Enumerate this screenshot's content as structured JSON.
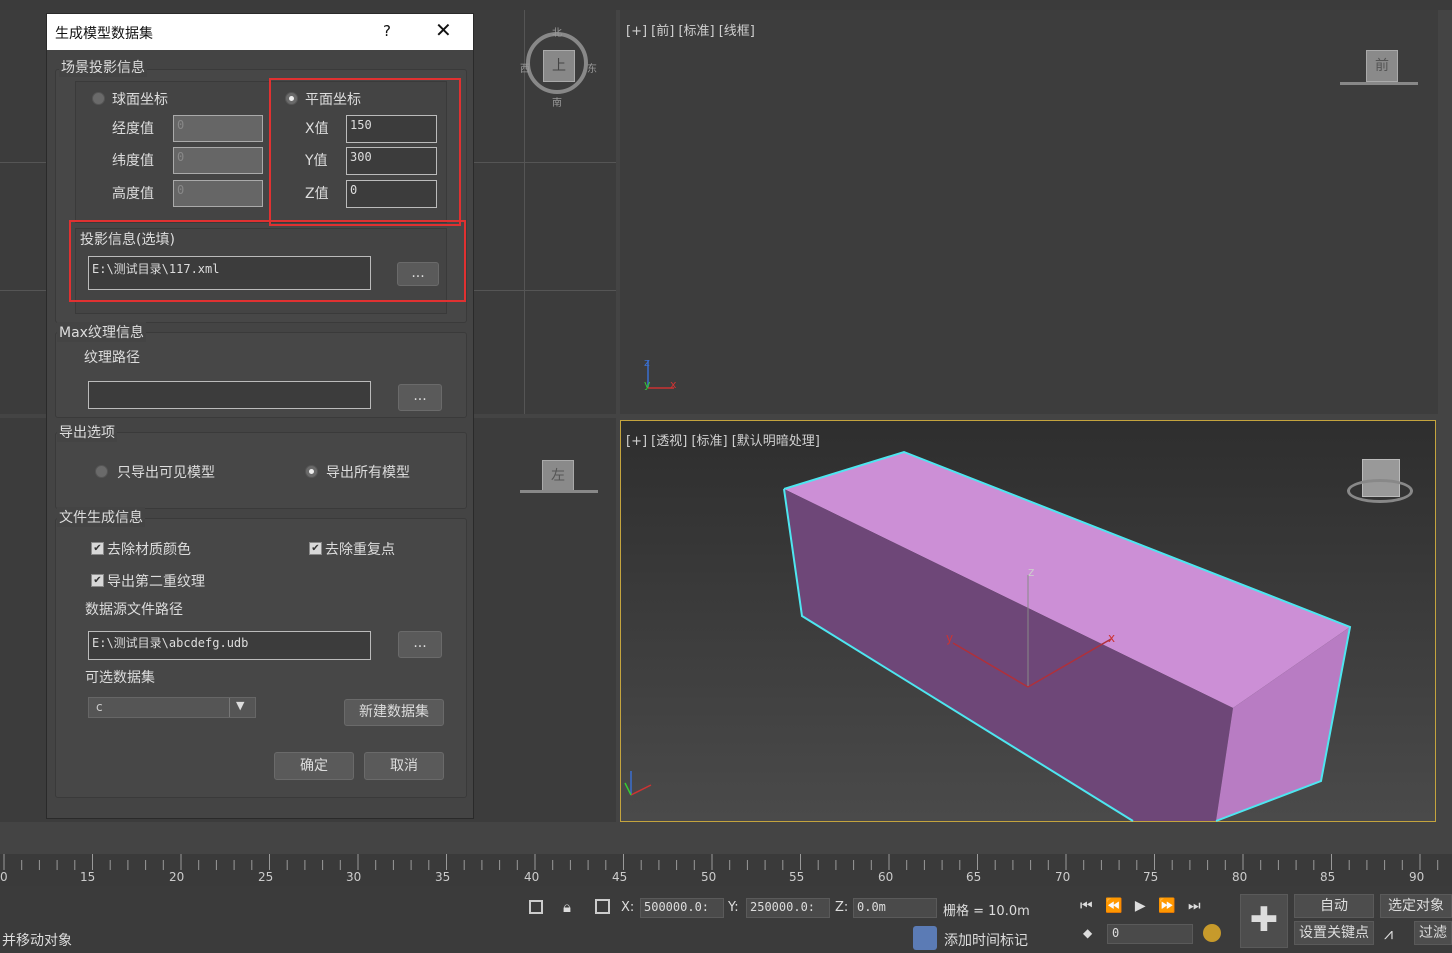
{
  "viewports": {
    "front_label": "[+] [前] [标准] [线框]",
    "persp_label": "[+] [透视] [标准] [默认明暗处理]",
    "viewcube_top": "上",
    "viewcube_front": "前",
    "viewcube_left": "左",
    "compass_n": "北",
    "compass_w": "西",
    "compass_e": "东",
    "compass_s": "南",
    "axis_x": "x",
    "axis_y": "y",
    "axis_z": "z"
  },
  "dialog": {
    "title": "生成模型数据集",
    "help": "?",
    "close": "✕",
    "projection_group": "场景投影信息",
    "spherical_label": "球面坐标",
    "planar_label": "平面坐标",
    "longitude_label": "经度值",
    "latitude_label": "纬度值",
    "height_label": "高度值",
    "longitude_value": "0",
    "latitude_value": "0",
    "height_value": "0",
    "x_label": "X值",
    "y_label": "Y值",
    "z_label": "Z值",
    "x_value": "150",
    "y_value": "300",
    "z_value": "0",
    "proj_info_label": "投影信息(选填)",
    "proj_info_path": "E:\\测试目录\\117.xml",
    "browse": "...",
    "texture_group": "Max纹理信息",
    "texture_path_label": "纹理路径",
    "texture_path_value": "",
    "export_group": "导出选项",
    "export_visible": "只导出可见模型",
    "export_all": "导出所有模型",
    "file_group": "文件生成信息",
    "remove_material": "去除材质颜色",
    "remove_duplicate": "去除重复点",
    "export_second_texture": "导出第二重纹理",
    "datasource_label": "数据源文件路径",
    "datasource_path": "E:\\测试目录\\abcdefg.udb",
    "dataset_label": "可选数据集",
    "dataset_value": "c",
    "new_dataset": "新建数据集",
    "ok": "确定",
    "cancel": "取消"
  },
  "timeline": {
    "ticks": [
      "0",
      "15",
      "20",
      "25",
      "30",
      "35",
      "40",
      "45",
      "50",
      "55",
      "60",
      "65",
      "70",
      "75",
      "80",
      "85",
      "90"
    ]
  },
  "status": {
    "prompt": "并移动对象",
    "x_label": "X:",
    "x_value": "500000.0:",
    "y_label": "Y:",
    "y_value": "250000.0:",
    "z_label": "Z:",
    "z_value": "0.0m",
    "grid_label": "栅格 = 10.0m",
    "add_time_tag": "添加时间标记",
    "frame_value": "0",
    "auto_key": "自动",
    "selected_object": "选定对象",
    "set_key": "设置关键点",
    "filter": "过滤"
  }
}
